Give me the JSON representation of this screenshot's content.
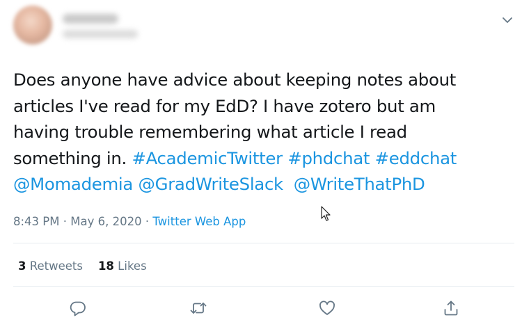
{
  "tweet": {
    "text_lines": [
      [
        {
          "t": "Does anyone have advice about keeping notes about",
          "link": false
        }
      ],
      [
        {
          "t": "articles I've read for my EdD? I have zotero but am",
          "link": false
        }
      ],
      [
        {
          "t": "having trouble remembering what article I read",
          "link": false
        }
      ],
      [
        {
          "t": "something in. ",
          "link": false
        },
        {
          "t": "#AcademicTwitter",
          "link": true,
          "name": "hashtag-academictwitter"
        },
        {
          "t": " ",
          "link": false
        },
        {
          "t": "#phdchat",
          "link": true,
          "name": "hashtag-phdchat"
        },
        {
          "t": " ",
          "link": false
        },
        {
          "t": "#eddchat",
          "link": true,
          "name": "hashtag-eddchat"
        }
      ],
      [
        {
          "t": "@Momademia",
          "link": true,
          "name": "mention-momademia"
        },
        {
          "t": " ",
          "link": false
        },
        {
          "t": "@GradWriteSlack",
          "link": true,
          "name": "mention-gradwriteslack"
        },
        {
          "t": "  ",
          "link": false
        },
        {
          "t": "@WriteThatPhD",
          "link": true,
          "name": "mention-writethatphd"
        }
      ]
    ]
  },
  "meta": {
    "time": "8:43 PM",
    "sep1": " · ",
    "date": "May 6, 2020",
    "sep2": " · ",
    "app": "Twitter Web App"
  },
  "stats": {
    "retweets_count": "3",
    "retweets_label": "Retweets",
    "likes_count": "18",
    "likes_label": "Likes"
  },
  "actions": {
    "reply_icon": "reply-icon",
    "retweet_icon": "retweet-icon",
    "like_icon": "like-icon",
    "share_icon": "share-icon",
    "more_icon": "chevron-down-icon"
  },
  "colors": {
    "text": "#14171a",
    "link": "#1b95e0",
    "secondary": "#657786",
    "divider": "#e6ecf0"
  }
}
